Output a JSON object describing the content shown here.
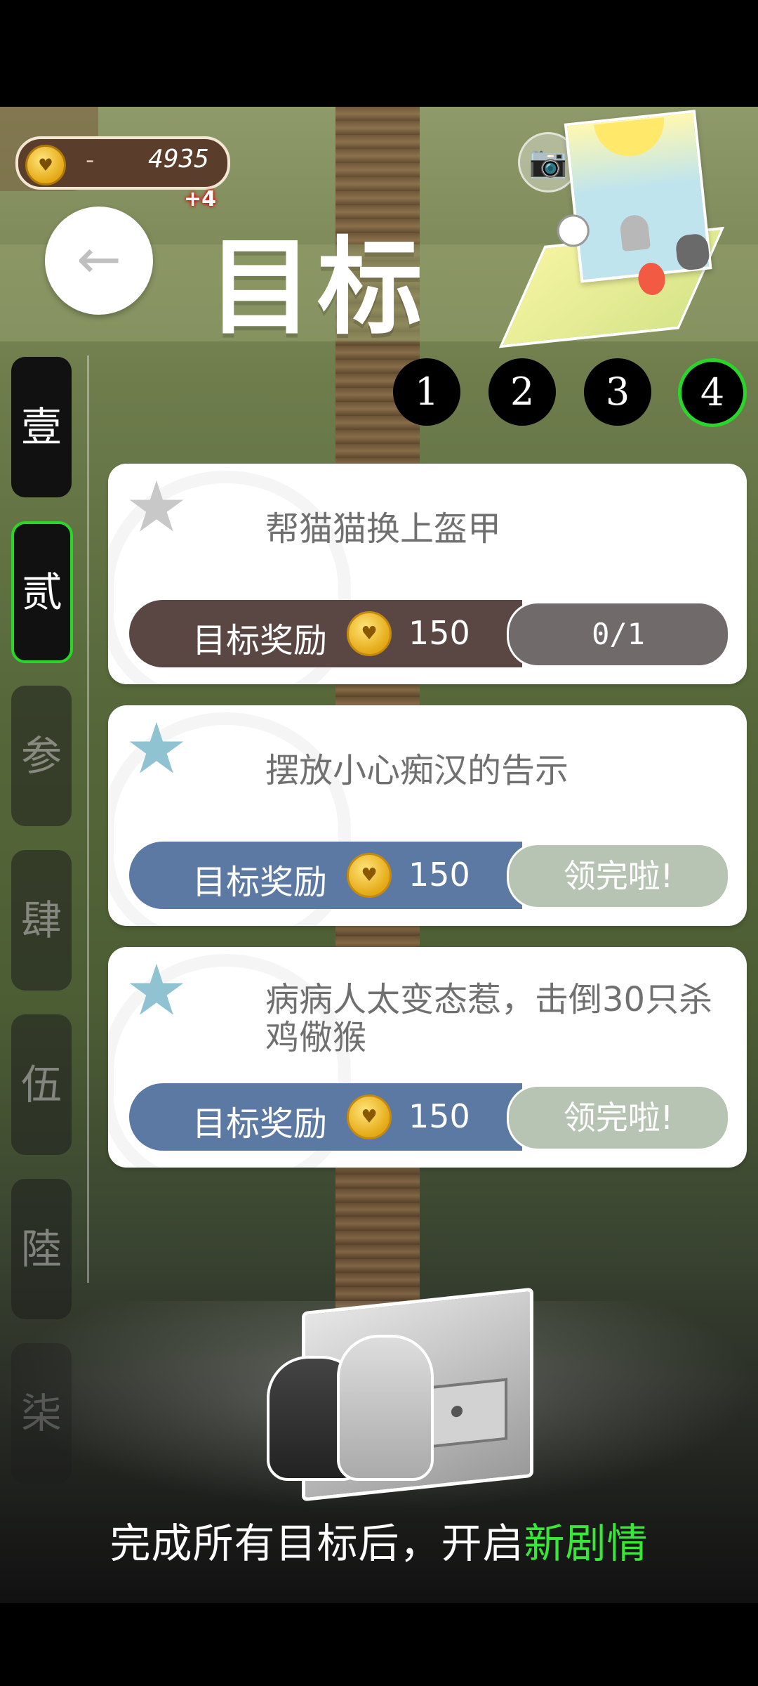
{
  "header": {
    "coins": "4935",
    "coin_separator": "-",
    "coin_gain": "+4",
    "back_arrow": "←",
    "title": "目标",
    "camera_glyph": "📷"
  },
  "chapter_tabs": [
    {
      "label": "壹",
      "state": "unlocked"
    },
    {
      "label": "贰",
      "state": "active"
    },
    {
      "label": "参",
      "state": "locked"
    },
    {
      "label": "肆",
      "state": "locked"
    },
    {
      "label": "伍",
      "state": "locked"
    },
    {
      "label": "陸",
      "state": "locked"
    },
    {
      "label": "柒",
      "state": "faded"
    }
  ],
  "pages": [
    {
      "label": "1",
      "active": false
    },
    {
      "label": "2",
      "active": false
    },
    {
      "label": "3",
      "active": false
    },
    {
      "label": "4",
      "active": true
    }
  ],
  "goals": [
    {
      "text": "帮猫猫换上盔甲",
      "reward_label": "目标奖励",
      "reward_amount": "150",
      "status": "0/1",
      "status_type": "progress",
      "star": "gray"
    },
    {
      "text": "摆放小心痴汉的告示",
      "reward_label": "目标奖励",
      "reward_amount": "150",
      "status": "领完啦!",
      "status_type": "done",
      "star": "blue"
    },
    {
      "text": "病病人太变态惹，击倒30只杀鸡儆猴",
      "reward_label": "目标奖励",
      "reward_amount": "150",
      "status": "领完啦!",
      "status_type": "done",
      "star": "blue"
    }
  ],
  "footer": {
    "message_prefix": "完成所有目标后，开启",
    "message_highlight": "新剧情"
  },
  "colors": {
    "active_green": "#2ad62a",
    "highlight_green": "#38e838",
    "reward_brown": "#5a4744",
    "reward_blue": "#5c79a3"
  }
}
